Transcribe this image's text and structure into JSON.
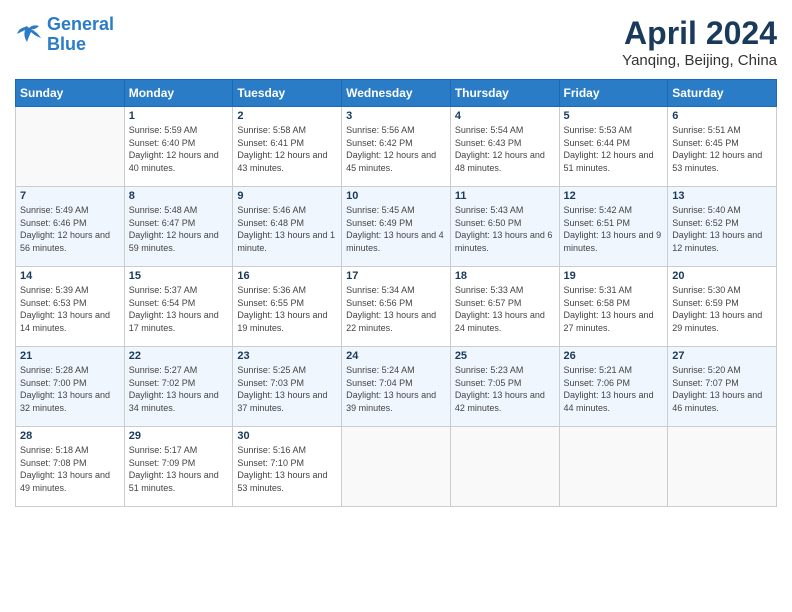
{
  "header": {
    "logo": {
      "line1": "General",
      "line2": "Blue"
    },
    "title": "April 2024",
    "location": "Yanqing, Beijing, China"
  },
  "weekdays": [
    "Sunday",
    "Monday",
    "Tuesday",
    "Wednesday",
    "Thursday",
    "Friday",
    "Saturday"
  ],
  "weeks": [
    [
      {
        "day": "",
        "sunrise": "",
        "sunset": "",
        "daylight": ""
      },
      {
        "day": "1",
        "sunrise": "Sunrise: 5:59 AM",
        "sunset": "Sunset: 6:40 PM",
        "daylight": "Daylight: 12 hours and 40 minutes."
      },
      {
        "day": "2",
        "sunrise": "Sunrise: 5:58 AM",
        "sunset": "Sunset: 6:41 PM",
        "daylight": "Daylight: 12 hours and 43 minutes."
      },
      {
        "day": "3",
        "sunrise": "Sunrise: 5:56 AM",
        "sunset": "Sunset: 6:42 PM",
        "daylight": "Daylight: 12 hours and 45 minutes."
      },
      {
        "day": "4",
        "sunrise": "Sunrise: 5:54 AM",
        "sunset": "Sunset: 6:43 PM",
        "daylight": "Daylight: 12 hours and 48 minutes."
      },
      {
        "day": "5",
        "sunrise": "Sunrise: 5:53 AM",
        "sunset": "Sunset: 6:44 PM",
        "daylight": "Daylight: 12 hours and 51 minutes."
      },
      {
        "day": "6",
        "sunrise": "Sunrise: 5:51 AM",
        "sunset": "Sunset: 6:45 PM",
        "daylight": "Daylight: 12 hours and 53 minutes."
      }
    ],
    [
      {
        "day": "7",
        "sunrise": "Sunrise: 5:49 AM",
        "sunset": "Sunset: 6:46 PM",
        "daylight": "Daylight: 12 hours and 56 minutes."
      },
      {
        "day": "8",
        "sunrise": "Sunrise: 5:48 AM",
        "sunset": "Sunset: 6:47 PM",
        "daylight": "Daylight: 12 hours and 59 minutes."
      },
      {
        "day": "9",
        "sunrise": "Sunrise: 5:46 AM",
        "sunset": "Sunset: 6:48 PM",
        "daylight": "Daylight: 13 hours and 1 minute."
      },
      {
        "day": "10",
        "sunrise": "Sunrise: 5:45 AM",
        "sunset": "Sunset: 6:49 PM",
        "daylight": "Daylight: 13 hours and 4 minutes."
      },
      {
        "day": "11",
        "sunrise": "Sunrise: 5:43 AM",
        "sunset": "Sunset: 6:50 PM",
        "daylight": "Daylight: 13 hours and 6 minutes."
      },
      {
        "day": "12",
        "sunrise": "Sunrise: 5:42 AM",
        "sunset": "Sunset: 6:51 PM",
        "daylight": "Daylight: 13 hours and 9 minutes."
      },
      {
        "day": "13",
        "sunrise": "Sunrise: 5:40 AM",
        "sunset": "Sunset: 6:52 PM",
        "daylight": "Daylight: 13 hours and 12 minutes."
      }
    ],
    [
      {
        "day": "14",
        "sunrise": "Sunrise: 5:39 AM",
        "sunset": "Sunset: 6:53 PM",
        "daylight": "Daylight: 13 hours and 14 minutes."
      },
      {
        "day": "15",
        "sunrise": "Sunrise: 5:37 AM",
        "sunset": "Sunset: 6:54 PM",
        "daylight": "Daylight: 13 hours and 17 minutes."
      },
      {
        "day": "16",
        "sunrise": "Sunrise: 5:36 AM",
        "sunset": "Sunset: 6:55 PM",
        "daylight": "Daylight: 13 hours and 19 minutes."
      },
      {
        "day": "17",
        "sunrise": "Sunrise: 5:34 AM",
        "sunset": "Sunset: 6:56 PM",
        "daylight": "Daylight: 13 hours and 22 minutes."
      },
      {
        "day": "18",
        "sunrise": "Sunrise: 5:33 AM",
        "sunset": "Sunset: 6:57 PM",
        "daylight": "Daylight: 13 hours and 24 minutes."
      },
      {
        "day": "19",
        "sunrise": "Sunrise: 5:31 AM",
        "sunset": "Sunset: 6:58 PM",
        "daylight": "Daylight: 13 hours and 27 minutes."
      },
      {
        "day": "20",
        "sunrise": "Sunrise: 5:30 AM",
        "sunset": "Sunset: 6:59 PM",
        "daylight": "Daylight: 13 hours and 29 minutes."
      }
    ],
    [
      {
        "day": "21",
        "sunrise": "Sunrise: 5:28 AM",
        "sunset": "Sunset: 7:00 PM",
        "daylight": "Daylight: 13 hours and 32 minutes."
      },
      {
        "day": "22",
        "sunrise": "Sunrise: 5:27 AM",
        "sunset": "Sunset: 7:02 PM",
        "daylight": "Daylight: 13 hours and 34 minutes."
      },
      {
        "day": "23",
        "sunrise": "Sunrise: 5:25 AM",
        "sunset": "Sunset: 7:03 PM",
        "daylight": "Daylight: 13 hours and 37 minutes."
      },
      {
        "day": "24",
        "sunrise": "Sunrise: 5:24 AM",
        "sunset": "Sunset: 7:04 PM",
        "daylight": "Daylight: 13 hours and 39 minutes."
      },
      {
        "day": "25",
        "sunrise": "Sunrise: 5:23 AM",
        "sunset": "Sunset: 7:05 PM",
        "daylight": "Daylight: 13 hours and 42 minutes."
      },
      {
        "day": "26",
        "sunrise": "Sunrise: 5:21 AM",
        "sunset": "Sunset: 7:06 PM",
        "daylight": "Daylight: 13 hours and 44 minutes."
      },
      {
        "day": "27",
        "sunrise": "Sunrise: 5:20 AM",
        "sunset": "Sunset: 7:07 PM",
        "daylight": "Daylight: 13 hours and 46 minutes."
      }
    ],
    [
      {
        "day": "28",
        "sunrise": "Sunrise: 5:18 AM",
        "sunset": "Sunset: 7:08 PM",
        "daylight": "Daylight: 13 hours and 49 minutes."
      },
      {
        "day": "29",
        "sunrise": "Sunrise: 5:17 AM",
        "sunset": "Sunset: 7:09 PM",
        "daylight": "Daylight: 13 hours and 51 minutes."
      },
      {
        "day": "30",
        "sunrise": "Sunrise: 5:16 AM",
        "sunset": "Sunset: 7:10 PM",
        "daylight": "Daylight: 13 hours and 53 minutes."
      },
      {
        "day": "",
        "sunrise": "",
        "sunset": "",
        "daylight": ""
      },
      {
        "day": "",
        "sunrise": "",
        "sunset": "",
        "daylight": ""
      },
      {
        "day": "",
        "sunrise": "",
        "sunset": "",
        "daylight": ""
      },
      {
        "day": "",
        "sunrise": "",
        "sunset": "",
        "daylight": ""
      }
    ]
  ]
}
